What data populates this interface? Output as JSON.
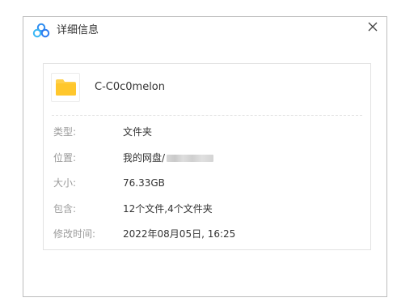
{
  "dialog": {
    "title": "详细信息",
    "logo_icon": "baidu-netdisk-cloud-icon",
    "close_icon": "close-icon"
  },
  "file": {
    "icon": "folder-icon",
    "name": "C-C0c0melon"
  },
  "details": [
    {
      "label": "类型:",
      "value": "文件夹"
    },
    {
      "label": "位置:",
      "value": "我的网盘/"
    },
    {
      "label": "大小:",
      "value": "76.33GB"
    },
    {
      "label": "包含:",
      "value": "12个文件,4个文件夹"
    },
    {
      "label": "修改时间:",
      "value": "2022年08月05日, 16:25"
    }
  ],
  "colors": {
    "logo_blue": "#2d8cf0",
    "folder_yellow": "#ffd04b",
    "label_gray": "#9a9a9a",
    "text_dark": "#333333"
  }
}
